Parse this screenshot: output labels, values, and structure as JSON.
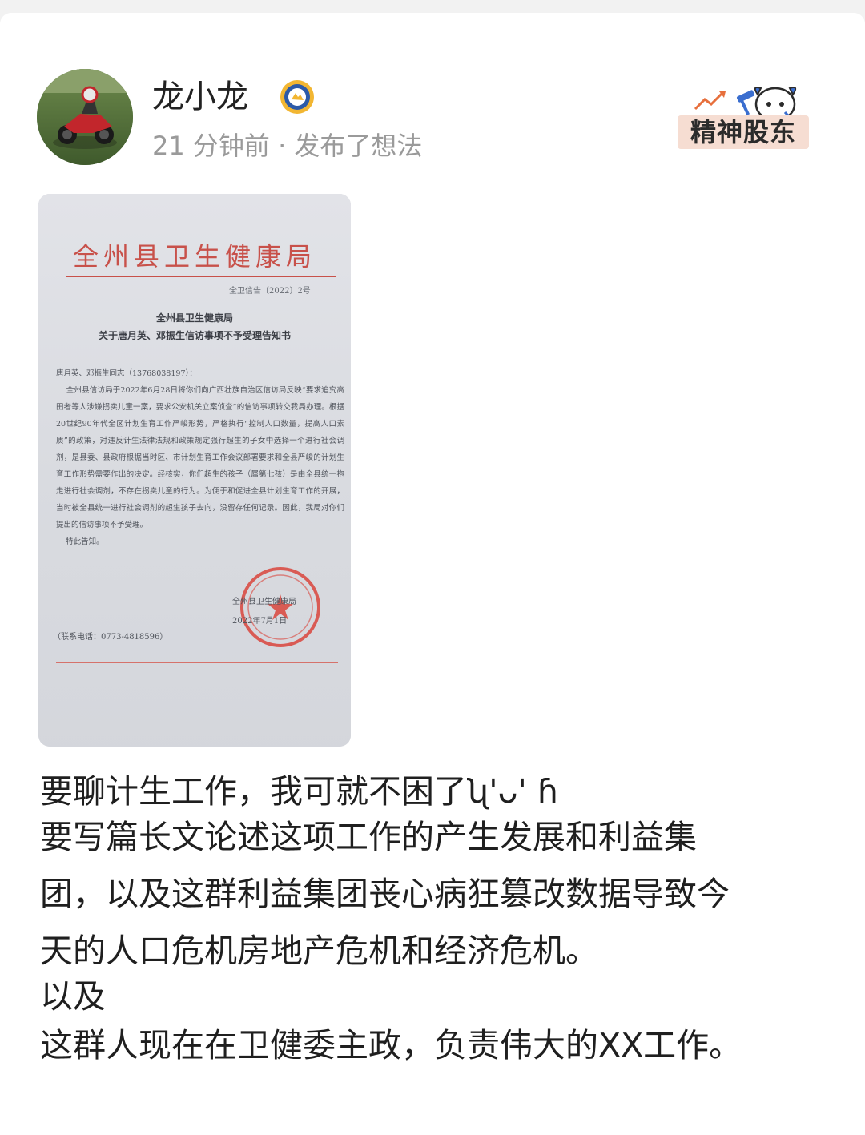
{
  "header": {
    "username": "龙小龙",
    "meta": "21 分钟前 · 发布了想法",
    "stamp_label": "精神股东",
    "badge_icon": "verified-badge-icon"
  },
  "document": {
    "org": "全州县卫生健康局",
    "ref": "全卫信告〔2022〕2号",
    "title_line1": "全州县卫生健康局",
    "title_line2": "关于唐月英、邓振生信访事项不予受理告知书",
    "body": "唐月英、邓振生同志（13768038197）：\n    全州县信访局于2022年6月28日将你们向广西壮族自治区信访局反映“要求追究高田者等人涉嫌拐卖儿童一案，要求公安机关立案侦查”的信访事项转交我局办理。根据20世纪90年代全区计划生育工作严峻形势，严格执行“控制人口数量，提高人口素质”的政策，对违反计生法律法规和政策规定强行超生的子女中选择一个进行社会调剂，是县委、县政府根据当时区、市计划生育工作会议部署要求和全县严峻的计划生育工作形势需要作出的决定。经核实，你们超生的孩子（属第七孩）是由全县统一抱走进行社会调剂，不存在拐卖儿童的行为。为便于和促进全县计划生育工作的开展，当时被全县统一进行社会调剂的超生孩子去向，没留存任何记录。因此，我局对你们提出的信访事项不予受理。\n    特此告知。",
    "signer": "全州县卫生健康局",
    "date": "2022年7月1日",
    "contact": "（联系电话：0773-4818596）"
  },
  "post": {
    "lines": [
      "要聊计生工作，我可就不困了ʯ'ᴗ' ɦ",
      "要写篇长文论述这项工作的产生发展和利益集",
      "团，以及这群利益集团丧心病狂篡改数据导致今",
      "天的人口危机房地产危机和经济危机。",
      "以及",
      "这群人现在在卫健委主政，负责伟大的XX工作。"
    ]
  }
}
